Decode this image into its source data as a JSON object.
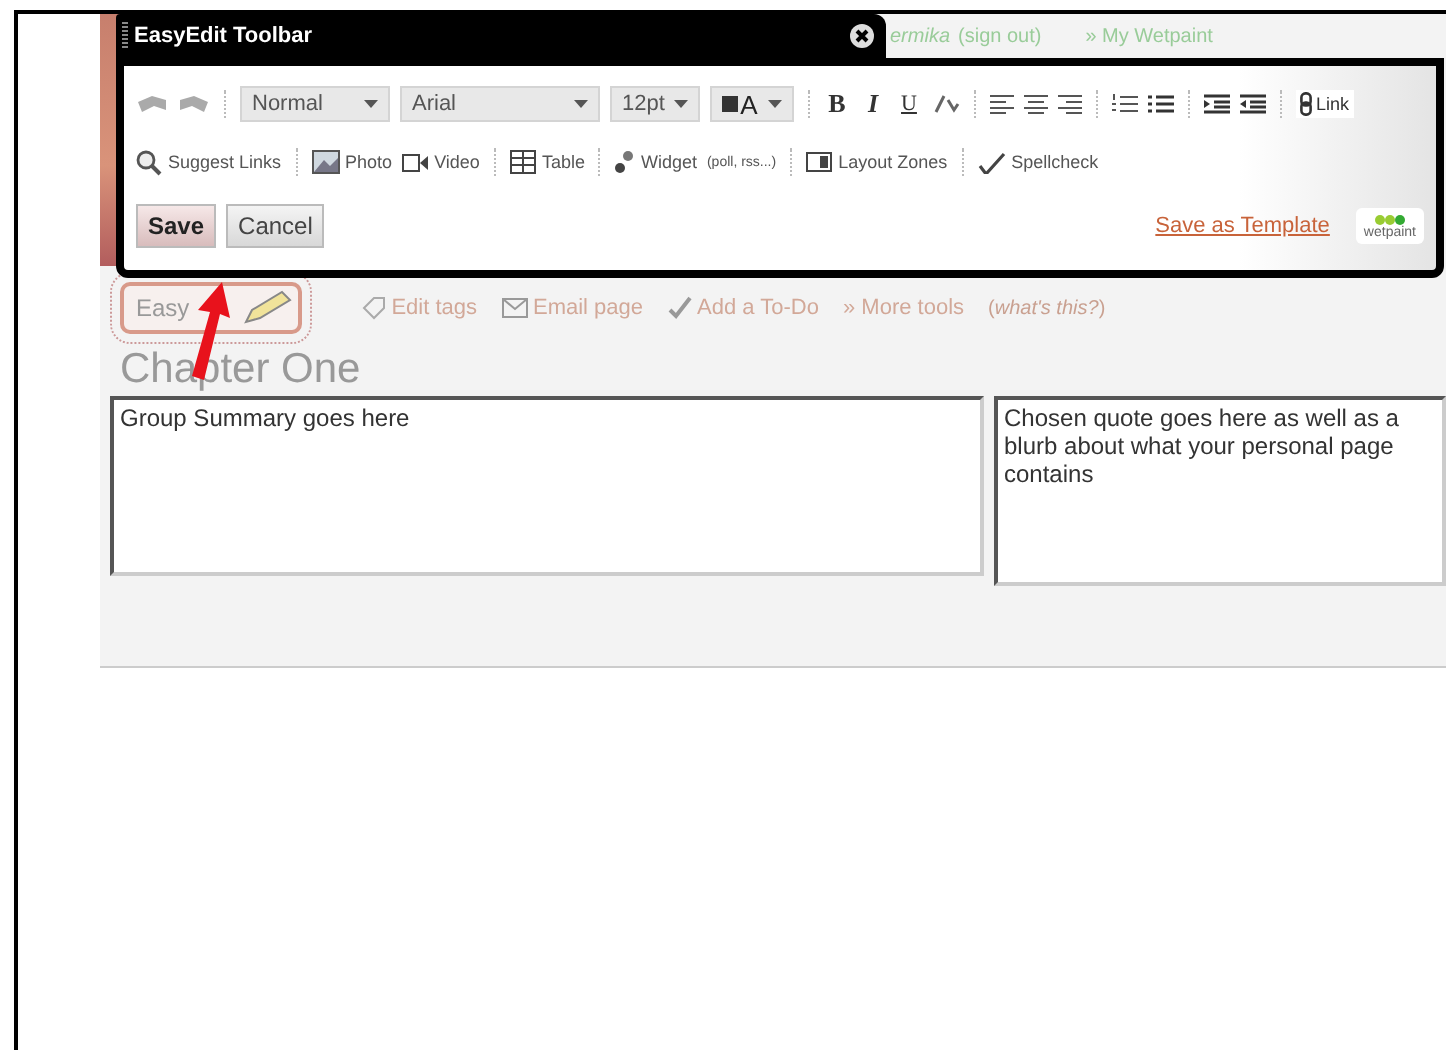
{
  "toolbar": {
    "title": "EasyEdit Toolbar",
    "style_select": "Normal",
    "font_select": "Arial",
    "size_select": "12pt",
    "color_button": "A",
    "bold": "B",
    "italic": "I",
    "underline": "U",
    "link": "Link",
    "insert_items": [
      {
        "kind": "search",
        "label": "Suggest Links"
      },
      {
        "kind": "photo",
        "label": "Photo"
      },
      {
        "kind": "video",
        "label": "Video"
      },
      {
        "kind": "table",
        "label": "Table"
      },
      {
        "kind": "widget",
        "label": "Widget",
        "note": "(poll, rss...)"
      },
      {
        "kind": "layout",
        "label": "Layout Zones"
      },
      {
        "kind": "spell",
        "label": "Spellcheck"
      }
    ],
    "save": "Save",
    "cancel": "Cancel",
    "save_template": "Save as Template",
    "logo": "wetpaint"
  },
  "user_bar": {
    "user": "ermika",
    "sign_out": "(sign out)",
    "my_wetpaint": "» My Wetpaint"
  },
  "page_tools": {
    "easyedit": "Easy",
    "items": [
      {
        "kind": "tag",
        "label": "Edit tags"
      },
      {
        "kind": "mail",
        "label": "Email page"
      },
      {
        "kind": "check",
        "label": "Add a To-Do"
      },
      {
        "kind": "more",
        "label": "» More tools"
      }
    ],
    "help": "(*what's this?*)"
  },
  "page_title": "Chapter One",
  "left_box": "Group Summary goes here",
  "right_box": "Chosen quote goes here as well as a blurb about what your personal page contains"
}
